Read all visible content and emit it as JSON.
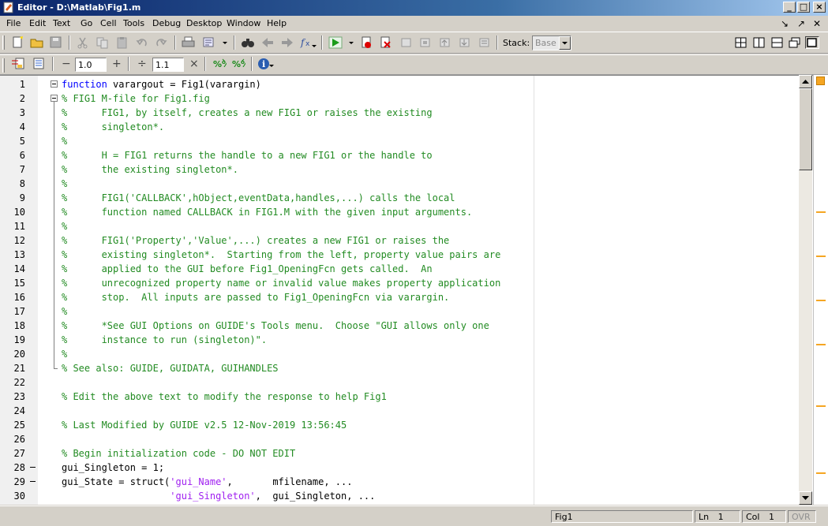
{
  "window": {
    "title": "Editor - D:\\Matlab\\Fig1.m",
    "controls": {
      "minimize": "_",
      "maximize": "□",
      "close": "×"
    }
  },
  "menubar": {
    "items": [
      "File",
      "Edit",
      "Text",
      "Go",
      "Cell",
      "Tools",
      "Debug",
      "Desktop",
      "Window",
      "Help"
    ]
  },
  "toolbar": {
    "stack_label": "Stack:",
    "stack_value": "Base",
    "cell_minus": "−",
    "cell_value1": "1.0",
    "cell_plus": "+",
    "cell_div": "÷",
    "cell_value2": "1.1"
  },
  "editor": {
    "lines": [
      {
        "n": "1",
        "fold": "open",
        "parts": [
          {
            "t": "kw",
            "s": "function"
          },
          {
            "t": "tx",
            "s": " varargout = Fig1(varargin)"
          }
        ]
      },
      {
        "n": "2",
        "fold": "open",
        "parts": [
          {
            "t": "cm",
            "s": "% FIG1 M-file for Fig1.fig"
          }
        ]
      },
      {
        "n": "3",
        "parts": [
          {
            "t": "cm",
            "s": "%      FIG1, by itself, creates a new FIG1 or raises the existing"
          }
        ]
      },
      {
        "n": "4",
        "parts": [
          {
            "t": "cm",
            "s": "%      singleton*."
          }
        ]
      },
      {
        "n": "5",
        "parts": [
          {
            "t": "cm",
            "s": "%"
          }
        ]
      },
      {
        "n": "6",
        "parts": [
          {
            "t": "cm",
            "s": "%      H = FIG1 returns the handle to a new FIG1 or the handle to"
          }
        ]
      },
      {
        "n": "7",
        "parts": [
          {
            "t": "cm",
            "s": "%      the existing singleton*."
          }
        ]
      },
      {
        "n": "8",
        "parts": [
          {
            "t": "cm",
            "s": "%"
          }
        ]
      },
      {
        "n": "9",
        "parts": [
          {
            "t": "cm",
            "s": "%      FIG1('CALLBACK',hObject,eventData,handles,...) calls the local"
          }
        ]
      },
      {
        "n": "10",
        "parts": [
          {
            "t": "cm",
            "s": "%      function named CALLBACK in FIG1.M with the given input arguments."
          }
        ]
      },
      {
        "n": "11",
        "parts": [
          {
            "t": "cm",
            "s": "%"
          }
        ]
      },
      {
        "n": "12",
        "parts": [
          {
            "t": "cm",
            "s": "%      FIG1('Property','Value',...) creates a new FIG1 or raises the"
          }
        ]
      },
      {
        "n": "13",
        "parts": [
          {
            "t": "cm",
            "s": "%      existing singleton*.  Starting from the left, property value pairs are"
          }
        ]
      },
      {
        "n": "14",
        "parts": [
          {
            "t": "cm",
            "s": "%      applied to the GUI before Fig1_OpeningFcn gets called.  An"
          }
        ]
      },
      {
        "n": "15",
        "parts": [
          {
            "t": "cm",
            "s": "%      unrecognized property name or invalid value makes property application"
          }
        ]
      },
      {
        "n": "16",
        "parts": [
          {
            "t": "cm",
            "s": "%      stop.  All inputs are passed to Fig1_OpeningFcn via varargin."
          }
        ]
      },
      {
        "n": "17",
        "parts": [
          {
            "t": "cm",
            "s": "%"
          }
        ]
      },
      {
        "n": "18",
        "parts": [
          {
            "t": "cm",
            "s": "%      *See GUI Options on GUIDE's Tools menu.  Choose \"GUI allows only one"
          }
        ]
      },
      {
        "n": "19",
        "parts": [
          {
            "t": "cm",
            "s": "%      instance to run (singleton)\"."
          }
        ]
      },
      {
        "n": "20",
        "parts": [
          {
            "t": "cm",
            "s": "%"
          }
        ]
      },
      {
        "n": "21",
        "fold": "end",
        "parts": [
          {
            "t": "cm",
            "s": "% See also: GUIDE, GUIDATA, GUIHANDLES"
          }
        ]
      },
      {
        "n": "22",
        "parts": []
      },
      {
        "n": "23",
        "parts": [
          {
            "t": "cm",
            "s": "% Edit the above text to modify the response to help Fig1"
          }
        ]
      },
      {
        "n": "24",
        "parts": []
      },
      {
        "n": "25",
        "parts": [
          {
            "t": "cm",
            "s": "% Last Modified by GUIDE v2.5 12-Nov-2019 13:56:45"
          }
        ]
      },
      {
        "n": "26",
        "parts": []
      },
      {
        "n": "27",
        "parts": [
          {
            "t": "cm",
            "s": "% Begin initialization code - DO NOT EDIT"
          }
        ]
      },
      {
        "n": "28",
        "bp": true,
        "parts": [
          {
            "t": "tx",
            "s": "gui_Singleton = 1;"
          }
        ]
      },
      {
        "n": "29",
        "bp": true,
        "parts": [
          {
            "t": "tx",
            "s": "gui_State = struct("
          },
          {
            "t": "st",
            "s": "'gui_Name'"
          },
          {
            "t": "tx",
            "s": ",       mfilename, ..."
          }
        ]
      },
      {
        "n": "30",
        "parts": [
          {
            "t": "tx",
            "s": "                   "
          },
          {
            "t": "st",
            "s": "'gui_Singleton'"
          },
          {
            "t": "tx",
            "s": ",  gui_Singleton, ..."
          }
        ]
      }
    ]
  },
  "statusbar": {
    "file": "Fig1",
    "ln_label": "Ln",
    "ln_value": "1",
    "col_label": "Col",
    "col_value": "1",
    "ovr": "OVR"
  },
  "colors": {
    "keyword": "#0000ff",
    "comment": "#228b22",
    "string": "#a020f0",
    "mlint_warning": "#f5a623"
  }
}
